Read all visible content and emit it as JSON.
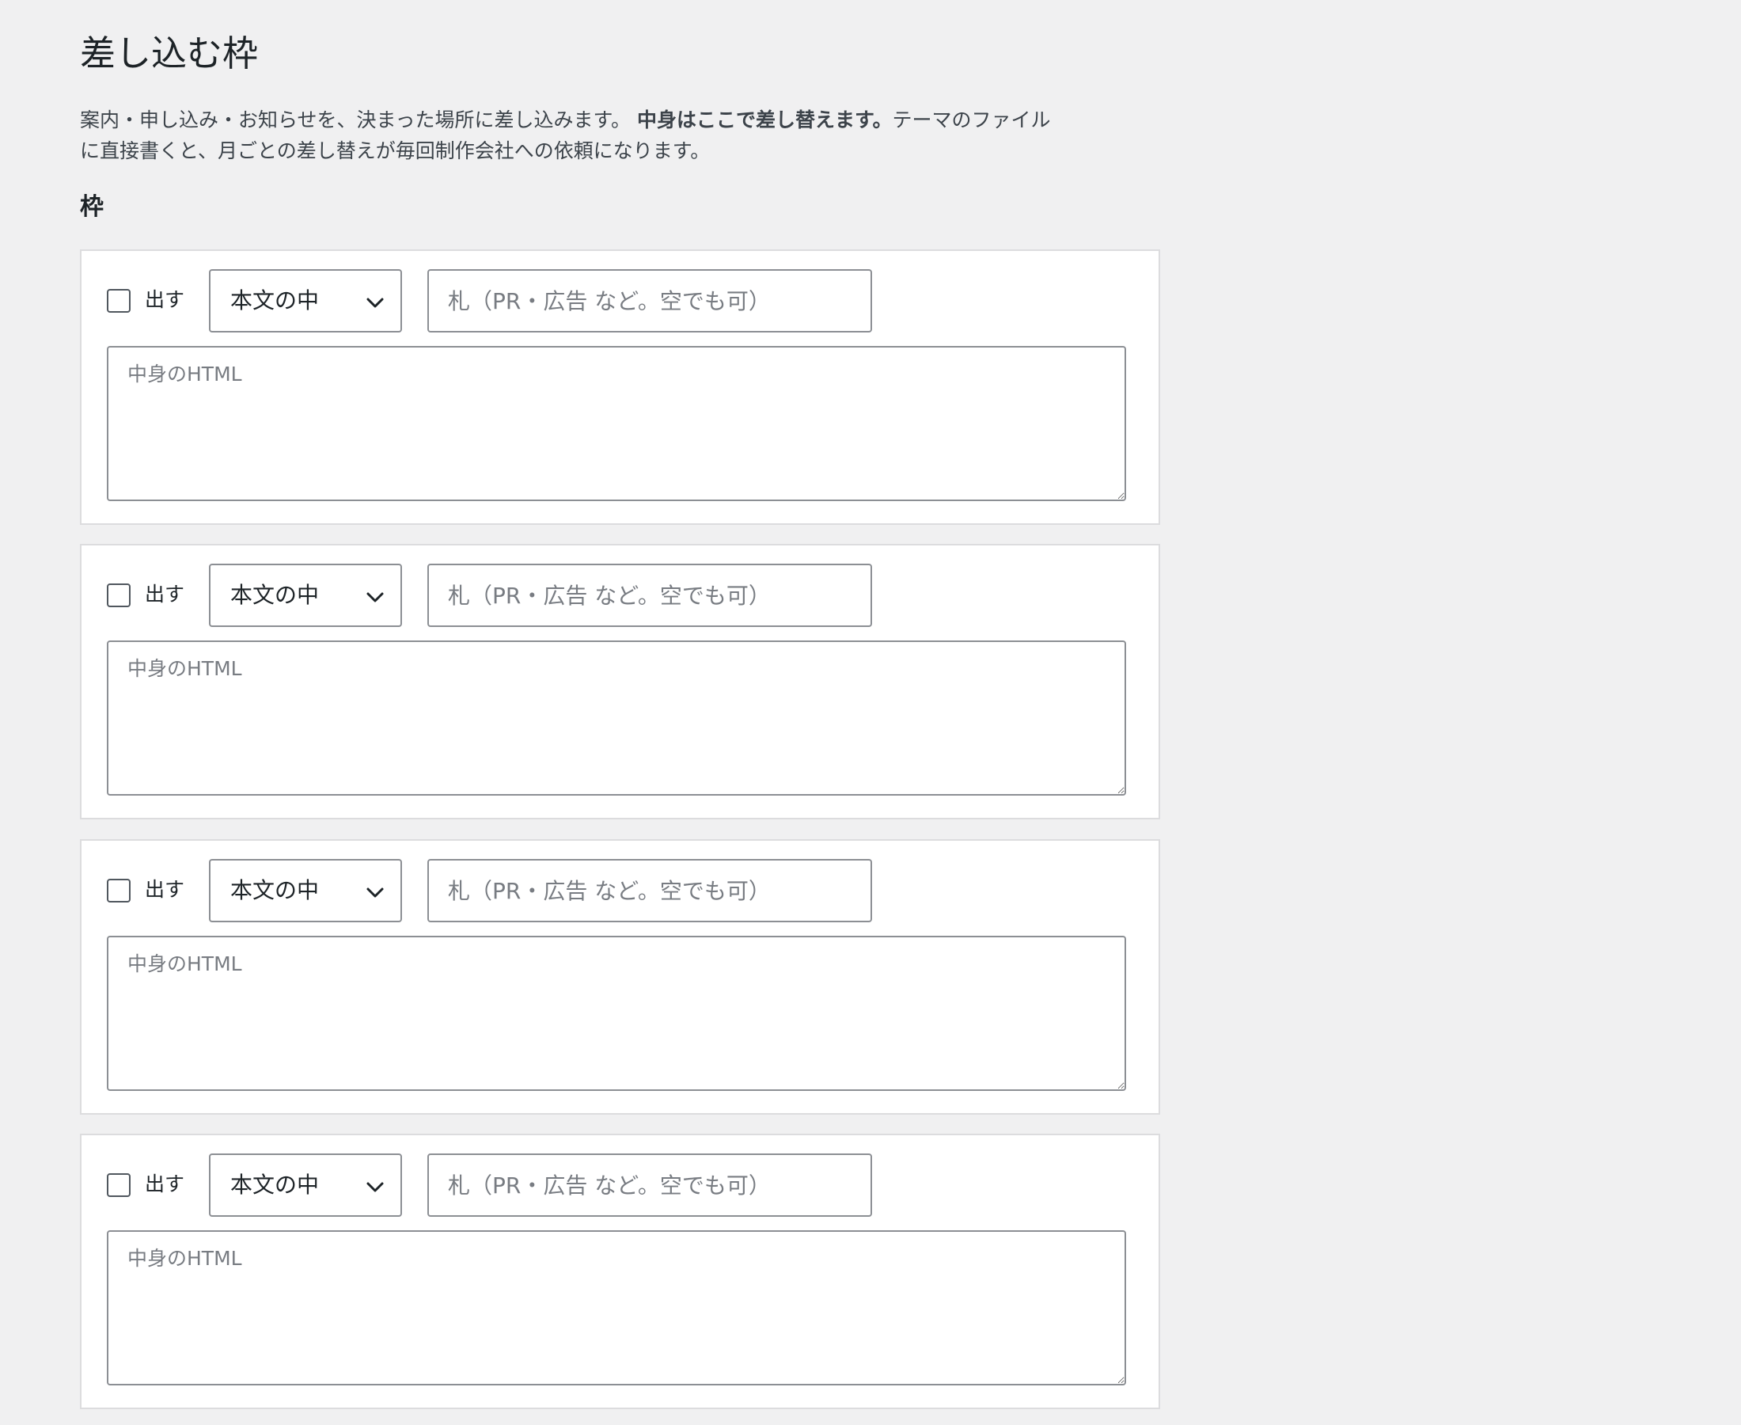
{
  "page": {
    "title": "差し込む枠",
    "description_part1": "案内・申し込み・お知らせを、決まった場所に差し込みます。",
    "description_bold": "中身はここで差し替えます。",
    "description_part2": "テーマのファイル",
    "description_line2": "に直接書くと、月ごとの差し替えが毎回制作会社への依頼になります。",
    "section_title": "枠"
  },
  "slots": [
    {
      "enabled": false,
      "checkbox_label": "出す",
      "position_value": "本文の中",
      "position_options": [
        "本文の中"
      ],
      "label_placeholder": "札（PR・広告 など。空でも可）",
      "label_value": "",
      "html_placeholder": "中身のHTML",
      "html_value": ""
    },
    {
      "enabled": false,
      "checkbox_label": "出す",
      "position_value": "本文の中",
      "position_options": [
        "本文の中"
      ],
      "label_placeholder": "札（PR・広告 など。空でも可）",
      "label_value": "",
      "html_placeholder": "中身のHTML",
      "html_value": ""
    },
    {
      "enabled": false,
      "checkbox_label": "出す",
      "position_value": "本文の中",
      "position_options": [
        "本文の中"
      ],
      "label_placeholder": "札（PR・広告 など。空でも可）",
      "label_value": "",
      "html_placeholder": "中身のHTML",
      "html_value": ""
    },
    {
      "enabled": false,
      "checkbox_label": "出す",
      "position_value": "本文の中",
      "position_options": [
        "本文の中"
      ],
      "label_placeholder": "札（PR・広告 など。空でも可）",
      "label_value": "",
      "html_placeholder": "中身のHTML",
      "html_value": ""
    }
  ],
  "icons": {
    "select_arrow": "chevron-down-icon"
  },
  "colors": {
    "background": "#f0f0f1",
    "card": "#ffffff",
    "border": "#8c8f94",
    "text": "#1d2327",
    "placeholder": "#787c82"
  }
}
